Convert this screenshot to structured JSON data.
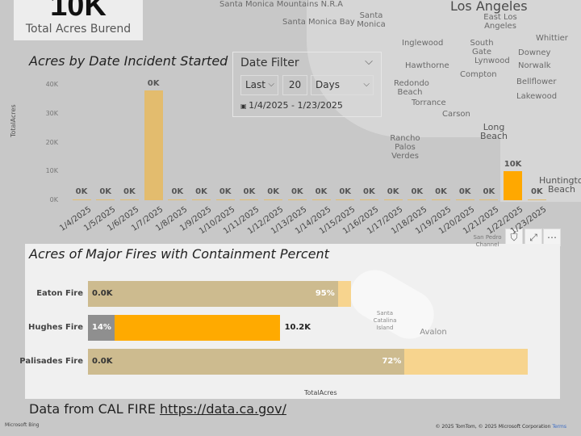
{
  "kpi": {
    "value": "10K",
    "label": "Total Acres Burend"
  },
  "map": {
    "labels": [
      "Santa Monica Mountains N.R.A",
      "Santa Monica Bay",
      "Santa Monica",
      "Los Angeles",
      "East Los Angeles",
      "Inglewood",
      "South Gate",
      "Downey",
      "Whittier",
      "Hawthorne",
      "Lynwood",
      "Norwalk",
      "Compton",
      "Redondo Beach",
      "Bellflower",
      "Torrance",
      "Lakewood",
      "Carson",
      "Long Beach",
      "Rancho Palos Verdes",
      "Huntington Beach",
      "San Pedro Channel",
      "Santa Catalina Island",
      "Avalon"
    ],
    "copyright": "© 2025 TomTom, © 2025 Microsoft Corporation",
    "terms": "Terms",
    "bing": "Microsoft Bing"
  },
  "date_chart": {
    "title": "Acres by Date Incident Started",
    "ylabel": "TotalAcres",
    "yticks": [
      "40K",
      "30K",
      "20K",
      "10K",
      "0K"
    ]
  },
  "chart_data": [
    {
      "type": "bar",
      "title": "Acres by Date Incident Started",
      "ylabel": "TotalAcres",
      "ylim": [
        0,
        40000
      ],
      "categories": [
        "1/4/2025",
        "1/5/2025",
        "1/6/2025",
        "1/7/2025",
        "1/8/2025",
        "1/9/2025",
        "1/10/2025",
        "1/11/2025",
        "1/12/2025",
        "1/13/2025",
        "1/14/2025",
        "1/15/2025",
        "1/16/2025",
        "1/17/2025",
        "1/18/2025",
        "1/19/2025",
        "1/20/2025",
        "1/21/2025",
        "1/22/2025",
        "1/23/2025"
      ],
      "values": [
        0,
        0,
        0,
        38000,
        80,
        100,
        10,
        0,
        0,
        5,
        5,
        5,
        0,
        0,
        0,
        0,
        0,
        5,
        10000,
        5
      ],
      "data_labels": [
        "0K",
        "0K",
        "0K",
        "0K",
        "0K",
        "0K",
        "0K",
        "0K",
        "0K",
        "0K",
        "0K",
        "0K",
        "0K",
        "0K",
        "0K",
        "0K",
        "0K",
        "0K",
        "10K",
        "0K"
      ],
      "highlight_color": "#FFA800",
      "color": "#E3BC6E"
    },
    {
      "type": "bar",
      "orientation": "horizontal",
      "title": "Acres of Major Fires with Containment Percent",
      "xlabel": "TotalAcres",
      "categories": [
        "Eaton Fire",
        "Hughes Fire",
        "Palisades Fire"
      ],
      "total_acres": [
        14000,
        10200,
        23400
      ],
      "containment_pct": [
        95,
        14,
        72
      ],
      "labels_left": [
        "0.0K",
        "14%",
        "0.0K"
      ],
      "labels_right": [
        "95%",
        "10.2K",
        "72%"
      ]
    }
  ],
  "filter": {
    "title": "Date Filter",
    "mode": "Last",
    "count": "20",
    "unit": "Days",
    "range": "1/4/2025 - 1/23/2025"
  },
  "footer": {
    "text": "Data from CAL FIRE ",
    "link": "https://data.ca.gov/"
  },
  "visual_icons": [
    "filter-icon",
    "focus-mode-icon",
    "more-options-icon"
  ]
}
